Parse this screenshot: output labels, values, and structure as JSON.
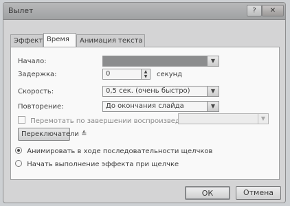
{
  "window": {
    "title": "Вылет",
    "help_label": "?",
    "close_label": "✕"
  },
  "tabs": [
    {
      "label": "Эффект",
      "active": false
    },
    {
      "label": "Время",
      "active": true
    },
    {
      "label": "Анимация текста",
      "active": false
    }
  ],
  "form": {
    "start": {
      "label": "Начало:",
      "value": "",
      "icon": "dropdown-arrow"
    },
    "delay": {
      "label": "Задержка:",
      "value": "0",
      "unit": "секунд"
    },
    "speed": {
      "label": "Скорость:",
      "value": "0,5 сек. (очень быстро)"
    },
    "repeat": {
      "label": "Повторение:",
      "value": "До окончания слайда"
    },
    "rewind": {
      "label": "Перемотать по завершении воспроизведения",
      "checked": false
    }
  },
  "triggers": {
    "button_label": "Переключатели",
    "option_sequence": "Анимировать в ходе последовательности щелчков",
    "option_on_click": "Начать выполнение эффекта при щелчке",
    "selected": "sequence"
  },
  "buttons": {
    "ok": "ОК",
    "cancel": "Отмена"
  }
}
